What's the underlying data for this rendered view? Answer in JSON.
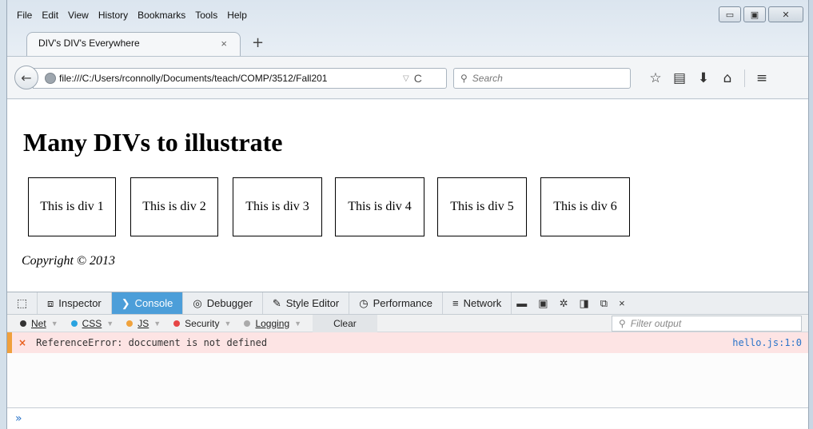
{
  "menu": [
    {
      "label": "File"
    },
    {
      "label": "Edit"
    },
    {
      "label": "View"
    },
    {
      "label": "History"
    },
    {
      "label": "Bookmarks"
    },
    {
      "label": "Tools"
    },
    {
      "label": "Help"
    }
  ],
  "window_controls": {
    "minimize": "▭",
    "maximize": "▣",
    "close": "✕"
  },
  "tab": {
    "title": "DIV's DIV's Everywhere",
    "close": "×",
    "new_tab": "+"
  },
  "navbar": {
    "back": "←",
    "url": "file:///C:/Users/rconnolly/Documents/teach/COMP/3512/Fall201",
    "url_dropdown": "▽",
    "reload": "C",
    "search_placeholder": "Search",
    "search_glyph": "⚲",
    "icons": [
      {
        "name": "bookmark-star-icon",
        "glyph": "☆"
      },
      {
        "name": "reading-list-icon",
        "glyph": "▤"
      },
      {
        "name": "downloads-icon",
        "glyph": "⬇"
      },
      {
        "name": "home-icon",
        "glyph": "⌂"
      },
      {
        "name": "menu-icon",
        "glyph": "≡"
      }
    ]
  },
  "page": {
    "heading": "Many DIVs to illustrate",
    "divs": [
      "This is div 1",
      "This is div 2",
      "This is div 3",
      "This is div 4",
      "This is div 5",
      "This is div 6"
    ],
    "copyright": "Copyright © 2013"
  },
  "devtools": {
    "picker": "⬚",
    "tabs": [
      {
        "label": "Inspector",
        "icon": "⧈"
      },
      {
        "label": "Console",
        "icon": "❯"
      },
      {
        "label": "Debugger",
        "icon": "◎"
      },
      {
        "label": "Style Editor",
        "icon": "✎"
      },
      {
        "label": "Performance",
        "icon": "◷"
      },
      {
        "label": "Network",
        "icon": "≡"
      }
    ],
    "right_icons": [
      {
        "name": "scratchpad-icon",
        "glyph": "▬"
      },
      {
        "name": "responsive-icon",
        "glyph": "▣"
      },
      {
        "name": "settings-icon",
        "glyph": "✲"
      },
      {
        "name": "dock-side-icon",
        "glyph": "◨"
      },
      {
        "name": "undock-icon",
        "glyph": "⧉"
      },
      {
        "name": "close-devtools-icon",
        "glyph": "×"
      }
    ],
    "filters": [
      {
        "label": "Net",
        "color": "#333333"
      },
      {
        "label": "CSS",
        "color": "#29a3e0"
      },
      {
        "label": "JS",
        "color": "#f0a23c"
      },
      {
        "label": "Security",
        "color": "#e64646"
      },
      {
        "label": "Logging",
        "color": "#aaaaaa"
      }
    ],
    "clear": "Clear",
    "filter_placeholder": "Filter output",
    "error": {
      "icon": "×",
      "message": "ReferenceError: doccument is not defined",
      "location": "hello.js:1:0"
    },
    "prompt": "»"
  }
}
